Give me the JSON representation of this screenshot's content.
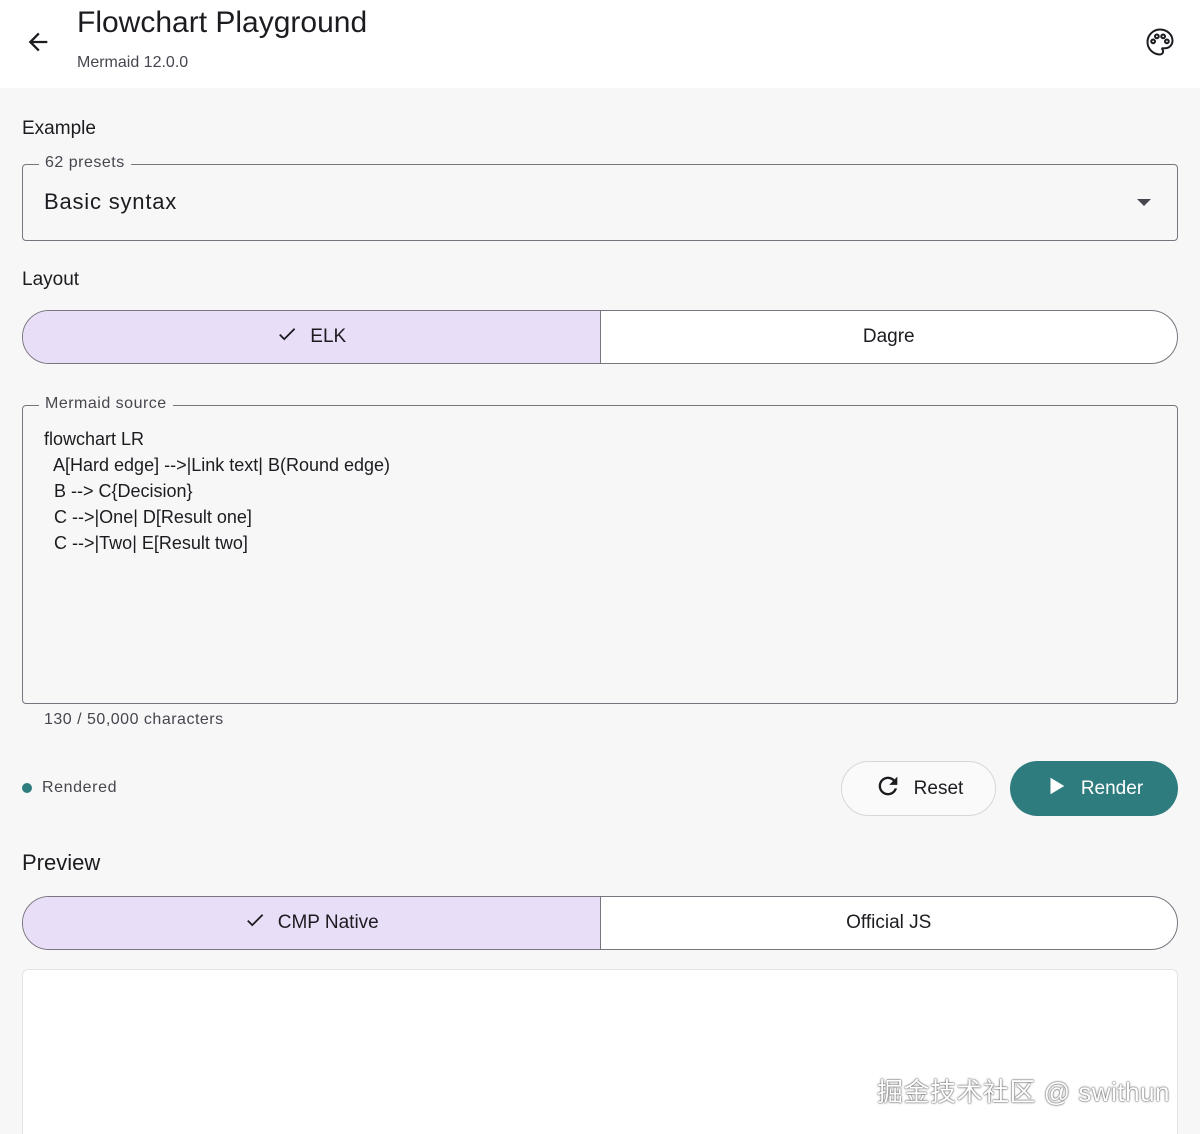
{
  "appbar": {
    "title": "Flowchart Playground",
    "subtitle": "Mermaid 12.0.0",
    "back_icon": "arrow-back-icon",
    "theme_icon": "palette-icon"
  },
  "example": {
    "section_label": "Example",
    "field_label": "62 presets",
    "selected": "Basic syntax"
  },
  "layout": {
    "section_label": "Layout",
    "options": [
      {
        "label": "ELK",
        "selected": true
      },
      {
        "label": "Dagre",
        "selected": false
      }
    ]
  },
  "source": {
    "field_label": "Mermaid source",
    "code": "flowchart LR\n  A[Hard edge] -->|Link text| B(Round edge)\n  B --> C{Decision}\n  C -->|One| D[Result one]\n  C -->|Two| E[Result two]",
    "char_count": "130 / 50,000 characters"
  },
  "status": {
    "text": "Rendered",
    "color": "#2f7c7f"
  },
  "actions": {
    "reset_label": "Reset",
    "render_label": "Render"
  },
  "preview": {
    "section_label": "Preview",
    "options": [
      {
        "label": "CMP Native",
        "selected": true
      },
      {
        "label": "Official JS",
        "selected": false
      }
    ]
  },
  "watermark": "掘金技术社区 @ swithun",
  "colors": {
    "accent": "#2f7c7f",
    "selected_segment": "#e8def8",
    "outline": "#79747e"
  }
}
